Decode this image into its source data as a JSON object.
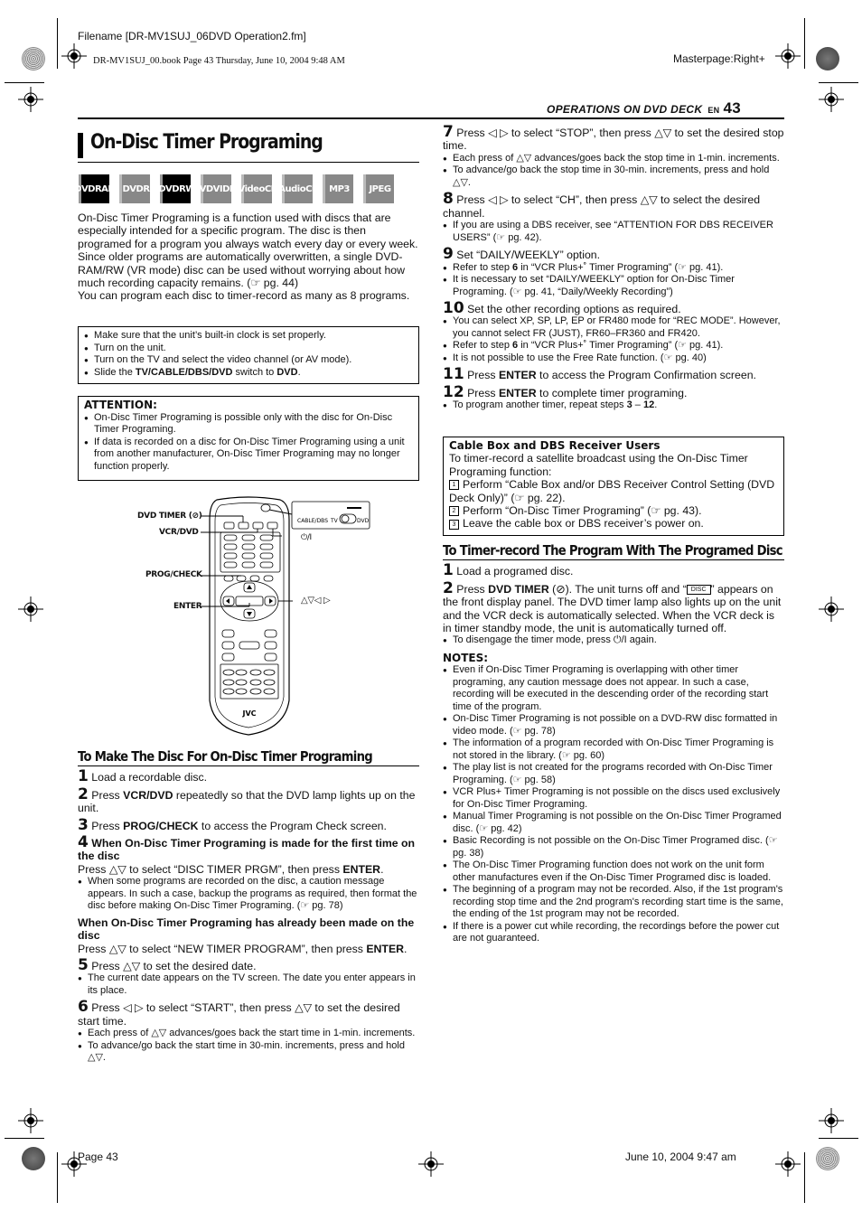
{
  "print_meta": {
    "filename": "Filename [DR-MV1SUJ_06DVD Operation2.fm]",
    "book_line": "DR-MV1SUJ_00.book  Page 43  Thursday, June 10, 2004  9:48 AM",
    "masterpage": "Masterpage:Right+",
    "footer_page": "Page 43",
    "footer_date": "June 10, 2004 9:47 am"
  },
  "header": {
    "section": "OPERATIONS ON DVD DECK",
    "lang": "EN",
    "page_number": "43"
  },
  "title": "On-Disc Timer Programing",
  "disc_badges": [
    {
      "line1": "DVD",
      "line2": "RAM",
      "active": true
    },
    {
      "line1": "DVD",
      "line2": "R",
      "active": false
    },
    {
      "line1": "DVD",
      "line2": "RW",
      "active": true
    },
    {
      "line1": "DVD",
      "line2": "VIDEO",
      "active": false
    },
    {
      "line1": "Video",
      "line2": "CD",
      "active": false
    },
    {
      "line1": "Audio",
      "line2": "CD",
      "active": false
    },
    {
      "line1": "MP3",
      "line2": "",
      "active": false
    },
    {
      "line1": "JPEG",
      "line2": "",
      "active": false
    }
  ],
  "intro": {
    "p1": "On-Disc Timer Programing is a function used with discs that are especially intended for a specific program. The disc is then programed for a program you always watch every day or every week. Since older programs are automatically overwritten, a single DVD-RAM/RW (VR mode) disc can be used without worrying about how much recording capacity remains. (☞ pg. 44)",
    "p2": "You can program each disc to timer-record as many as 8 programs."
  },
  "prep_box": {
    "items": [
      "Make sure that the unit’s built-in clock is set properly.",
      "Turn on the unit.",
      "Turn on the TV and select the video channel (or AV mode)."
    ],
    "last_prefix": "Slide the ",
    "last_bold1": "TV/CABLE/DBS/DVD",
    "last_mid": " switch to ",
    "last_bold2": "DVD",
    "last_suffix": "."
  },
  "attention": {
    "heading": "ATTENTION:",
    "items": [
      "On-Disc Timer Programing is possible only with the disc for On-Disc Timer Programing.",
      "If data is recorded on a disc for On-Disc Timer Programing using a unit from another manufacturer, On-Disc Timer Programing may no longer function properly."
    ]
  },
  "remote": {
    "callouts": {
      "dvd_timer": "DVD TIMER (⊘)",
      "vcr_dvd": "VCR/DVD",
      "prog_check": "PROG/CHECK",
      "enter": "ENTER",
      "power": "⏻/I",
      "arrows": "△▽◁ ▷"
    },
    "switch_labels": {
      "cable": "CABLE/DBS",
      "tv": "TV",
      "dvd": "DVD"
    },
    "brand": "JVC"
  },
  "make_disc": {
    "heading": "To Make The Disc For On-Disc Timer Programing",
    "s1": {
      "n": "1",
      "text": "Load a recordable disc."
    },
    "s2": {
      "n": "2",
      "pre": "Press ",
      "bold": "VCR/DVD",
      "post": " repeatedly so that the DVD lamp lights up on the unit."
    },
    "s3": {
      "n": "3",
      "pre": "Press ",
      "bold": "PROG/CHECK",
      "post": " to access the Program Check screen."
    },
    "s4": {
      "n": "4",
      "bold_head": "When On-Disc Timer Programing is made for the first time on the disc",
      "pre": "Press △▽ to select “DISC TIMER PRGM”, then press ",
      "bold": "ENTER",
      "post": ".",
      "bullet": "When some programs are recorded on the disc, a caution message appears. In such a case, backup the programs as required, then format the disc before making On-Disc Timer Programing. (☞ pg. 78)",
      "alt_head": "When On-Disc Timer Programing has already been made on the disc",
      "alt_pre": "Press △▽ to select “NEW TIMER PROGRAM”, then press ",
      "alt_bold": "ENTER",
      "alt_post": "."
    },
    "s5": {
      "n": "5",
      "text": "Press △▽ to set the desired date.",
      "bullet": "The current date appears on the TV screen. The date you enter appears in its place."
    },
    "s6": {
      "n": "6",
      "text": "Press ◁ ▷ to select “START”, then press △▽ to set the desired start time.",
      "bullets": [
        "Each press of △▽ advances/goes back the start time in 1-min. increments.",
        "To advance/go back the start time in 30-min. increments, press and hold △▽."
      ]
    }
  },
  "right_steps": {
    "s7": {
      "n": "7",
      "text": "Press ◁ ▷ to select “STOP”, then press △▽ to set the desired stop time.",
      "bullets": [
        "Each press of △▽ advances/goes back the stop time in 1-min. increments.",
        "To advance/go back the stop time in 30-min. increments, press and hold △▽."
      ]
    },
    "s8": {
      "n": "8",
      "text": "Press ◁ ▷ to select “CH”, then press △▽ to select the desired channel.",
      "bullets": [
        "If you are using a DBS receiver, see “ATTENTION FOR DBS RECEIVER USERS” (☞ pg. 42)."
      ]
    },
    "s9": {
      "n": "9",
      "text": "Set “DAILY/WEEKLY” option.",
      "b1_pre": "Refer to step ",
      "b1_bold": "6",
      "b1_post": " in “VCR Plus+˚ Timer Programing” (☞ pg. 41).",
      "b2": "It is necessary to set “DAILY/WEEKLY” option for On-Disc Timer Programing. (☞ pg. 41, “Daily/Weekly Recording”)"
    },
    "s10": {
      "n": "10",
      "text": "Set the other recording options as required.",
      "b1": "You can select XP, SP, LP, EP or FR480 mode for “REC MODE”. However, you cannot select FR (JUST), FR60–FR360 and FR420.",
      "b2_pre": "Refer to step ",
      "b2_bold": "6",
      "b2_post": " in “VCR Plus+˚ Timer Programing” (☞ pg. 41).",
      "b3": "It is not possible to use the Free Rate function. (☞ pg. 40)"
    },
    "s11": {
      "n": "11",
      "pre": "Press ",
      "bold": "ENTER",
      "post": " to access the Program Confirmation screen."
    },
    "s12": {
      "n": "12",
      "pre": "Press ",
      "bold": "ENTER",
      "post": " to complete timer programing.",
      "b_pre": "To program another timer, repeat steps ",
      "b_bold1": "3",
      "b_mid": " – ",
      "b_bold2": "12",
      "b_post": "."
    }
  },
  "cable_box": {
    "heading": "Cable Box and DBS Receiver Users",
    "intro": "To timer-record a satellite broadcast using the On-Disc Timer Programing function:",
    "steps": [
      {
        "n": "1",
        "text": "Perform “Cable Box and/or DBS Receiver Control Setting (DVD Deck Only)” (☞ pg. 22)."
      },
      {
        "n": "2",
        "text": "Perform “On-Disc Timer Programing” (☞ pg. 43)."
      },
      {
        "n": "3",
        "text": "Leave the cable box or DBS receiver’s power on."
      }
    ]
  },
  "timer_record": {
    "heading": "To Timer-record The Program With The Programed Disc",
    "s1": {
      "n": "1",
      "text": "Load a programed disc."
    },
    "s2": {
      "n": "2",
      "pre": "Press ",
      "bold": "DVD TIMER",
      "mid": " (⊘). The unit turns off and “",
      "disc": "DISC",
      "post": "” appears on the front display panel. The DVD timer lamp also lights up on the unit and the VCR deck is automatically selected. When the VCR deck is in timer standby mode, the unit is automatically turned off.",
      "bullet": "To disengage the timer mode, press ⏻/I again."
    },
    "notes_heading": "NOTES:",
    "notes": [
      "Even if On-Disc Timer Programing is overlapping with other timer programing, any caution message does not appear. In such a case, recording will be executed in the descending order of the recording start time of the program.",
      "On-Disc Timer Programing is not possible on a DVD-RW disc formatted in video mode. (☞ pg. 78)",
      "The information of a program recorded with On-Disc Timer Programing is not stored in the library. (☞ pg. 60)",
      "The play list is not created for the programs recorded with On-Disc Timer Programing. (☞ pg. 58)",
      "VCR Plus+ Timer Programing is not possible on the discs used exclusively for On-Disc Timer Programing.",
      "Manual Timer Programing is not possible on the On-Disc Timer Programed disc. (☞ pg. 42)",
      "Basic Recording is not possible on the On-Disc Timer Programed disc. (☞ pg. 38)",
      "The On-Disc Timer Programing function does not work on the unit form other manufactures even if the On-Disc Timer Programed disc is loaded.",
      "The beginning of a program may not be recorded. Also, if the 1st program's recording stop time and the 2nd program's recording start time is the same, the ending of the 1st program may not be recorded.",
      "If there is a power cut while recording, the recordings before the power cut are not guaranteed."
    ]
  }
}
